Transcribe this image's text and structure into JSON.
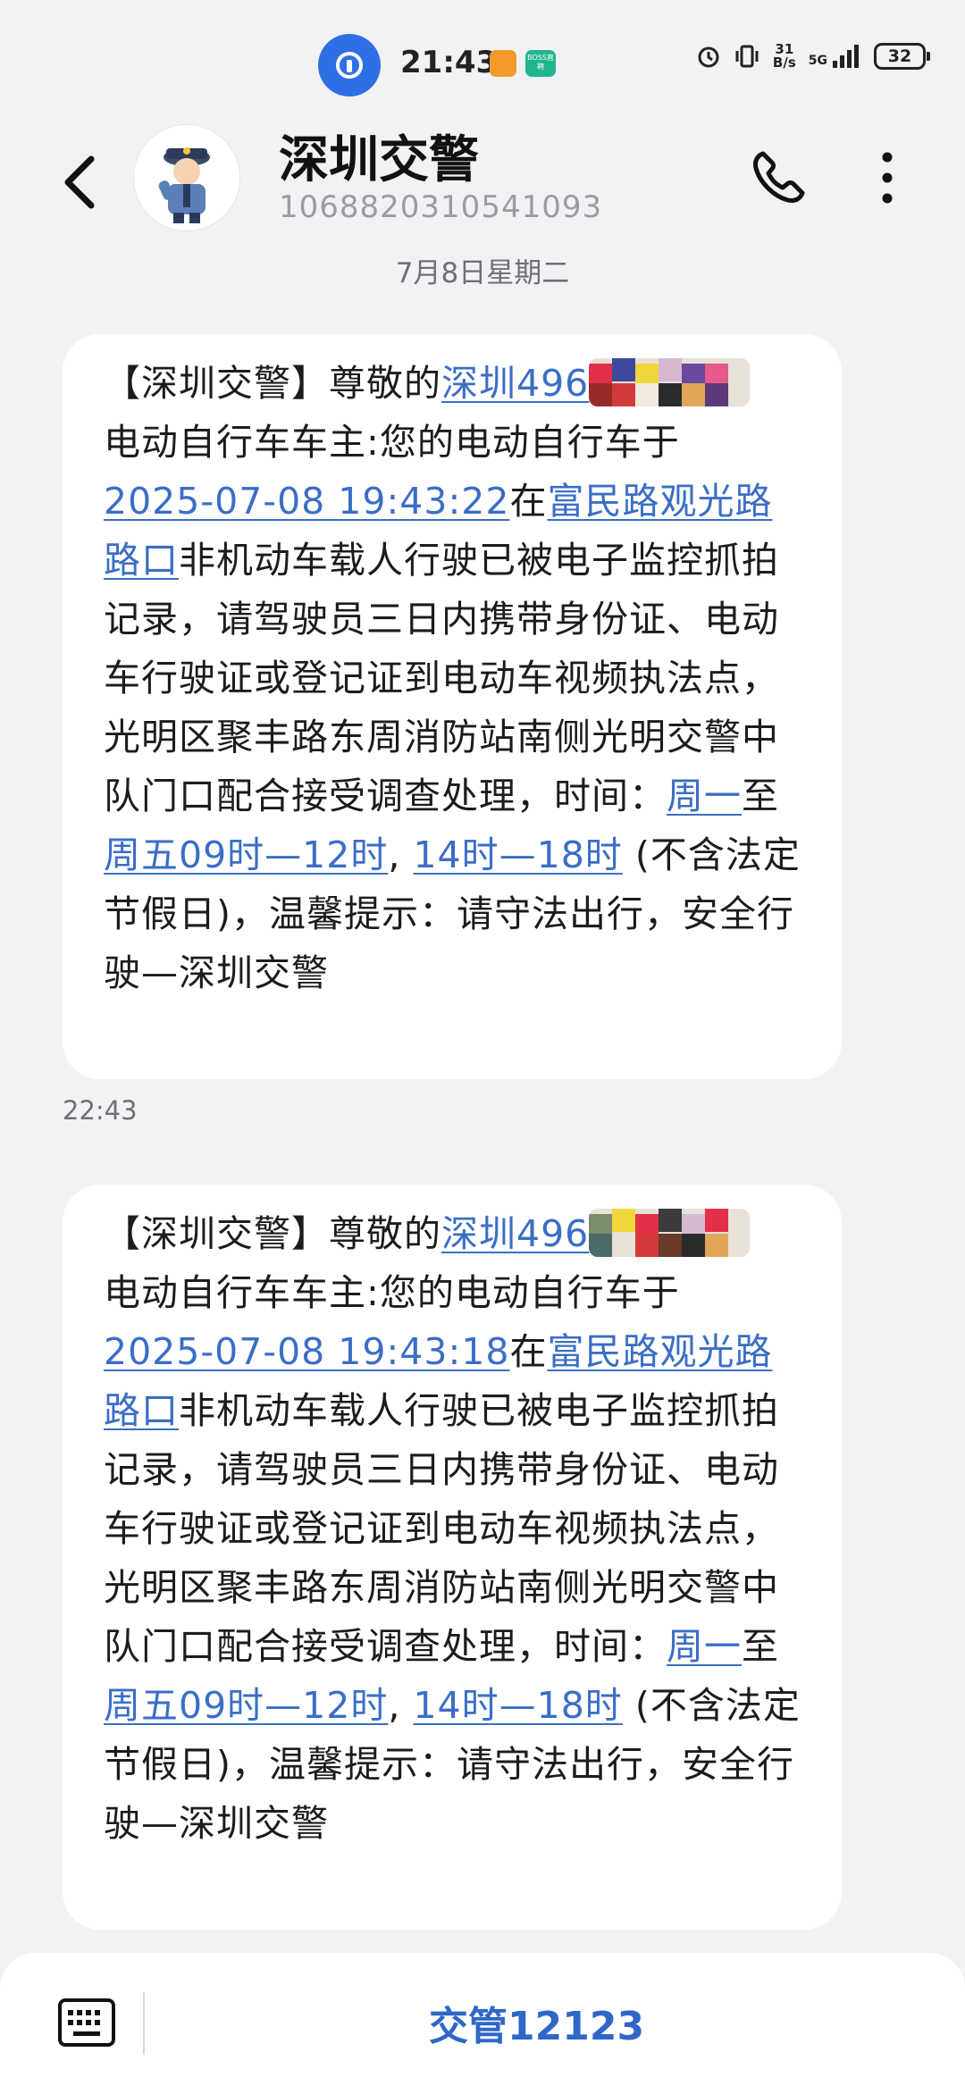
{
  "status": {
    "time": "21:43",
    "badge_text": "BOSS直聘",
    "net_speed_value": "31",
    "net_speed_unit": "B/s",
    "network": "5G",
    "battery": "32"
  },
  "header": {
    "contact_name": "深圳交警",
    "contact_number": "1068820310541093"
  },
  "date_separator": "7月8日星期二",
  "messages": [
    {
      "prefix": "【深圳交警】尊敬的",
      "plate_link": "深圳496",
      "line_owner": "电动自行车车主:您的电动自行车于",
      "datetime_link": "2025-07-08 19:43:22",
      "at": "在",
      "road_link": "富民路观光路路口",
      "body": "非机动车载人行驶已被电子监控抓拍记录，请驾驶员三日内携带身份证、电动车行驶证或登记证到电动车视频执法点，光明区聚丰路东周消防站南侧光明交警中队门口配合接受调查处理，时间：",
      "day1_link": "周一",
      "to": "至",
      "range1_link": "周五09时—12时",
      "comma": ",",
      "range2_link": "14时—18时",
      "tail": "(不含法定节假日)，温馨提示：请守法出行，安全行驶—深圳交警",
      "time": "22:43"
    },
    {
      "prefix": "【深圳交警】尊敬的",
      "plate_link": "深圳496",
      "line_owner": "电动自行车车主:您的电动自行车于",
      "datetime_link": "2025-07-08 19:43:18",
      "at": "在",
      "road_link": "富民路观光路路口",
      "body": "非机动车载人行驶已被电子监控抓拍记录，请驾驶员三日内携带身份证、电动车行驶证或登记证到电动车视频执法点，光明区聚丰路东周消防站南侧光明交警中队门口配合接受调查处理，时间：",
      "day1_link": "周一",
      "to": "至",
      "range1_link": "周五09时—12时",
      "comma": ",",
      "range2_link": "14时—18时",
      "tail": "(不含法定节假日)，温馨提示：请守法出行，安全行驶—深圳交警"
    }
  ],
  "bottom": {
    "menu_label": "交管12123"
  },
  "icons": {
    "app": "key-lock-icon",
    "back": "chevron-left-icon",
    "call": "phone-icon",
    "more": "more-vertical-icon",
    "keyboard": "keyboard-icon",
    "avatar": "police-avatar"
  },
  "colors": {
    "link": "#3a6ec6",
    "bubble": "#ffffff",
    "background": "#f1f2f4",
    "menu": "#2f67c9"
  }
}
